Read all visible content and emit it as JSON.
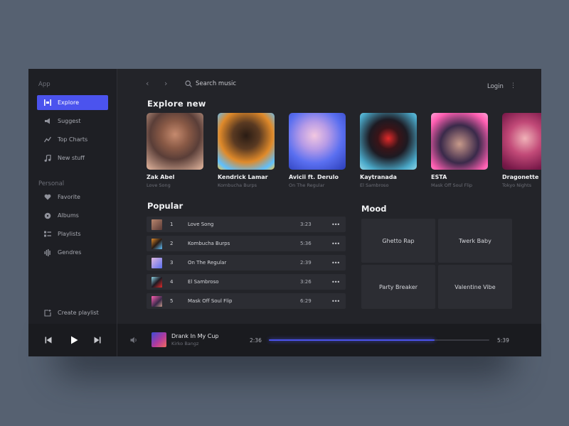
{
  "sidebar": {
    "app_label": "App",
    "personal_label": "Personal",
    "app_items": [
      {
        "label": "Explore",
        "icon": "explore-icon",
        "active": true
      },
      {
        "label": "Suggest",
        "icon": "megaphone-icon"
      },
      {
        "label": "Top Charts",
        "icon": "chart-icon"
      },
      {
        "label": "New stuff",
        "icon": "music-note-icon"
      }
    ],
    "personal_items": [
      {
        "label": "Favorite",
        "icon": "heart-icon"
      },
      {
        "label": "Albums",
        "icon": "disc-icon"
      },
      {
        "label": "Playlists",
        "icon": "list-icon"
      },
      {
        "label": "Gendres",
        "icon": "waveform-icon"
      }
    ],
    "create_playlist": "Create playlist"
  },
  "topbar": {
    "search_placeholder": "Search music",
    "login": "Login"
  },
  "explore": {
    "title": "Explore new",
    "artists": [
      {
        "name": "Zak Abel",
        "song": "Love Song"
      },
      {
        "name": "Kendrick Lamar",
        "song": "Kombucha Burps"
      },
      {
        "name": "Avicii ft. Derulo",
        "song": "On The Regular"
      },
      {
        "name": "Kaytranada",
        "song": "El Sambroso"
      },
      {
        "name": "ESTA",
        "song": "Mask Off Soul Flip"
      },
      {
        "name": "Dragonette",
        "song": "Tokyo Nights"
      }
    ]
  },
  "popular": {
    "title": "Popular",
    "tracks": [
      {
        "num": "1",
        "title": "Love Song",
        "duration": "3:23"
      },
      {
        "num": "2",
        "title": "Kombucha Burps",
        "duration": "5:36"
      },
      {
        "num": "3",
        "title": "On The Regular",
        "duration": "2:39"
      },
      {
        "num": "4",
        "title": "El Sambroso",
        "duration": "3:26"
      },
      {
        "num": "5",
        "title": "Mask Off Soul Flip",
        "duration": "6:29"
      }
    ],
    "more_label": "•••"
  },
  "mood": {
    "title": "Mood",
    "items": [
      "Ghetto Rap",
      "Twerk Baby",
      "Party Breaker",
      "Valentine Vibe"
    ]
  },
  "player": {
    "track_title": "Drank In My Cup",
    "artist": "Kirko Bangz",
    "current_time": "2:36",
    "total_time": "5:39",
    "progress": 0.75
  },
  "colors": {
    "accent": "#4b53ee",
    "background": "#566171",
    "panel": "#232429"
  }
}
